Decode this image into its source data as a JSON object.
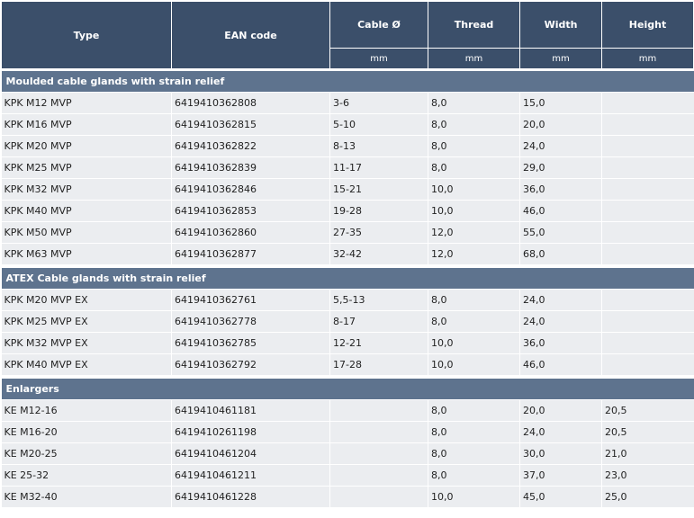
{
  "headers": {
    "type": "Type",
    "ean": "EAN code",
    "cable": "Cable Ø",
    "thread": "Thread",
    "width": "Width",
    "height": "Height"
  },
  "units": {
    "cable": "mm",
    "thread": "mm",
    "width": "mm",
    "height": "mm"
  },
  "groups": [
    {
      "title": "Moulded cable glands with strain relief",
      "rows": [
        [
          "KPK M12 MVP",
          "6419410362808",
          "3-6",
          "8,0",
          "15,0",
          ""
        ],
        [
          "KPK M16 MVP",
          "6419410362815",
          "5-10",
          "8,0",
          "20,0",
          ""
        ],
        [
          "KPK M20 MVP",
          "6419410362822",
          "8-13",
          "8,0",
          "24,0",
          ""
        ],
        [
          "KPK M25 MVP",
          "6419410362839",
          "11-17",
          "8,0",
          "29,0",
          ""
        ],
        [
          "KPK M32 MVP",
          "6419410362846",
          "15-21",
          "10,0",
          "36,0",
          ""
        ],
        [
          "KPK M40 MVP",
          "6419410362853",
          "19-28",
          "10,0",
          "46,0",
          ""
        ],
        [
          "KPK M50 MVP",
          "6419410362860",
          "27-35",
          "12,0",
          "55,0",
          ""
        ],
        [
          "KPK M63 MVP",
          "6419410362877",
          "32-42",
          "12,0",
          "68,0",
          ""
        ]
      ]
    },
    {
      "title": "ATEX Cable glands with strain relief",
      "rows": [
        [
          "KPK M20 MVP EX",
          "6419410362761",
          "5,5-13",
          "8,0",
          "24,0",
          ""
        ],
        [
          "KPK M25 MVP EX",
          "6419410362778",
          "8-17",
          "8,0",
          "24,0",
          ""
        ],
        [
          "KPK M32 MVP EX",
          "6419410362785",
          "12-21",
          "10,0",
          "36,0",
          ""
        ],
        [
          "KPK M40 MVP EX",
          "6419410362792",
          "17-28",
          "10,0",
          "46,0",
          ""
        ]
      ]
    },
    {
      "title": "Enlargers",
      "rows": [
        [
          "KE M12-16",
          "6419410461181",
          "",
          "8,0",
          "20,0",
          "20,5"
        ],
        [
          "KE M16-20",
          "6419410261198",
          "",
          "8,0",
          "24,0",
          "20,5"
        ],
        [
          "KE M20-25",
          "6419410461204",
          "",
          "8,0",
          "30,0",
          "21,0"
        ],
        [
          "KE 25-32",
          "6419410461211",
          "",
          "8,0",
          "37,0",
          "23,0"
        ],
        [
          "KE M32-40",
          "6419410461228",
          "",
          "10,0",
          "45,0",
          "25,0"
        ]
      ]
    }
  ]
}
